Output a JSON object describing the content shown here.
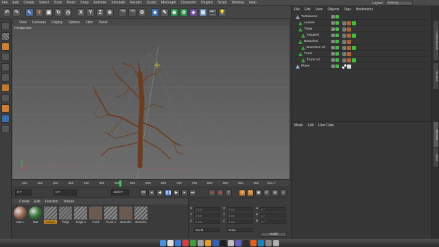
{
  "menubar": {
    "items": [
      "File",
      "Edit",
      "Create",
      "Select",
      "Tools",
      "Mesh",
      "Snap",
      "Animate",
      "Simulate",
      "Render",
      "Sculpt",
      "MoGraph",
      "Character",
      "Plugins",
      "Script",
      "Window",
      "Help"
    ],
    "layout_label": "Layout:",
    "layout_value": "Startup"
  },
  "viewport": {
    "menu": [
      "View",
      "Cameras",
      "Display",
      "Options",
      "Filter",
      "Panel"
    ],
    "label": "Perspective"
  },
  "timeline": {
    "ticks": [
      "200",
      "250",
      "300",
      "350",
      "400",
      "450",
      "500",
      "550",
      "600",
      "650",
      "700",
      "750",
      "800",
      "850",
      "900",
      "950"
    ],
    "current_frame_label": "521 F"
  },
  "transport": {
    "start_field": "0 F",
    "current_field": "0 F",
    "end_field": "1000 F"
  },
  "materials": {
    "menu": [
      "Create",
      "Edit",
      "Function",
      "Texture"
    ],
    "items": [
      {
        "name": "Mat.1",
        "color": "#9a6a52"
      },
      {
        "name": "Mat",
        "color": "#3b7a3b"
      },
      {
        "name": "Leaves",
        "color": "#8a8a8a"
      },
      {
        "name": "Twigs",
        "color": "#7d7d7d"
      },
      {
        "name": "Twigs n",
        "color": "#8e8e8e"
      },
      {
        "name": "Trunk",
        "color": "#7b5a48"
      },
      {
        "name": "Trunk n",
        "color": "#8f8f8f"
      },
      {
        "name": "Branche",
        "color": "#7a5a4a"
      },
      {
        "name": "Branche",
        "color": "#8a8a8a"
      }
    ]
  },
  "coords": {
    "labels": [
      "X",
      "Y",
      "Z",
      "X",
      "Y",
      "Z",
      "H",
      "P",
      "B"
    ],
    "fields": [
      "0 cm",
      "0 cm",
      "0 cm",
      "0 cm",
      "0 cm",
      "0 cm",
      "0 °",
      "0 °",
      "0 °"
    ],
    "dropdown1": "World",
    "dropdown2": "Scale",
    "apply": "Apply"
  },
  "objects": {
    "menu": [
      "File",
      "Edit",
      "View",
      "Objects",
      "Tags",
      "Bookmarks"
    ],
    "rows": [
      {
        "name": "Turbulence",
        "indent": 0,
        "icon_color": "#a0a0c0"
      },
      {
        "name": "Leaves",
        "indent": 1,
        "icon_color": "#3aa03a"
      },
      {
        "name": "Twigs",
        "indent": 1,
        "icon_color": "#3aa03a"
      },
      {
        "name": "Twigsref",
        "indent": 2,
        "icon_color": "#3aa03a"
      },
      {
        "name": "Branches",
        "indent": 1,
        "icon_color": "#3aa03a"
      },
      {
        "name": "Branches ref",
        "indent": 2,
        "icon_color": "#3aa03a"
      },
      {
        "name": "Trunk",
        "indent": 1,
        "icon_color": "#3aa03a"
      },
      {
        "name": "Trunk ref",
        "indent": 2,
        "icon_color": "#3aa03a"
      },
      {
        "name": "Plane",
        "indent": 0,
        "icon_color": "#8fb0e0"
      }
    ]
  },
  "attributes": {
    "menu": [
      "Mode",
      "Edit",
      "User Data"
    ]
  },
  "sidetabs": [
    "Content Browser",
    "Structure",
    "Attributes",
    "Layers"
  ],
  "colors": {
    "accent_green": "#2fd070",
    "tree_brown": "#6b3e24",
    "play_highlight": "#4a7ad0"
  }
}
